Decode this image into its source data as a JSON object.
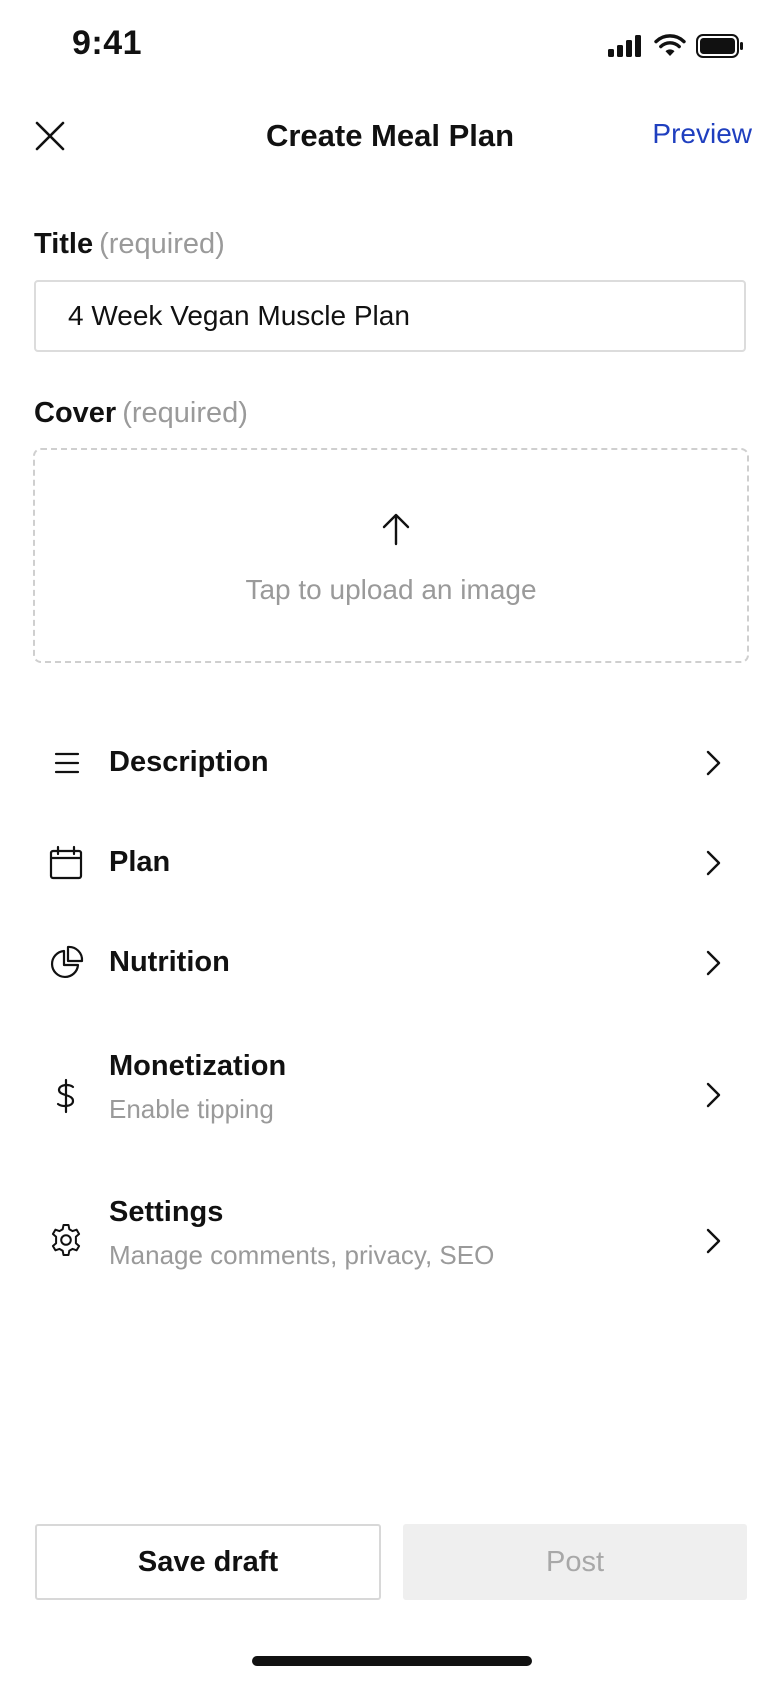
{
  "status_bar": {
    "time": "9:41"
  },
  "nav": {
    "title": "Create Meal Plan",
    "preview_label": "Preview",
    "accent_color": "#1f3fbf"
  },
  "title_field": {
    "label": "Title",
    "required_hint": "(required)",
    "value": "4 Week Vegan Muscle Plan"
  },
  "cover_field": {
    "label": "Cover",
    "required_hint": "(required)",
    "upload_text": "Tap to upload an image"
  },
  "menu": {
    "items": [
      {
        "title": "Description",
        "subtitle": "",
        "icon": "align-left-icon"
      },
      {
        "title": "Plan",
        "subtitle": "",
        "icon": "calendar-icon"
      },
      {
        "title": "Nutrition",
        "subtitle": "",
        "icon": "pie-chart-icon"
      },
      {
        "title": "Monetization",
        "subtitle": "Enable tipping",
        "icon": "dollar-icon"
      },
      {
        "title": "Settings",
        "subtitle": "Manage comments, privacy, SEO",
        "icon": "gear-icon"
      }
    ]
  },
  "footer": {
    "save_label": "Save draft",
    "post_label": "Post"
  }
}
